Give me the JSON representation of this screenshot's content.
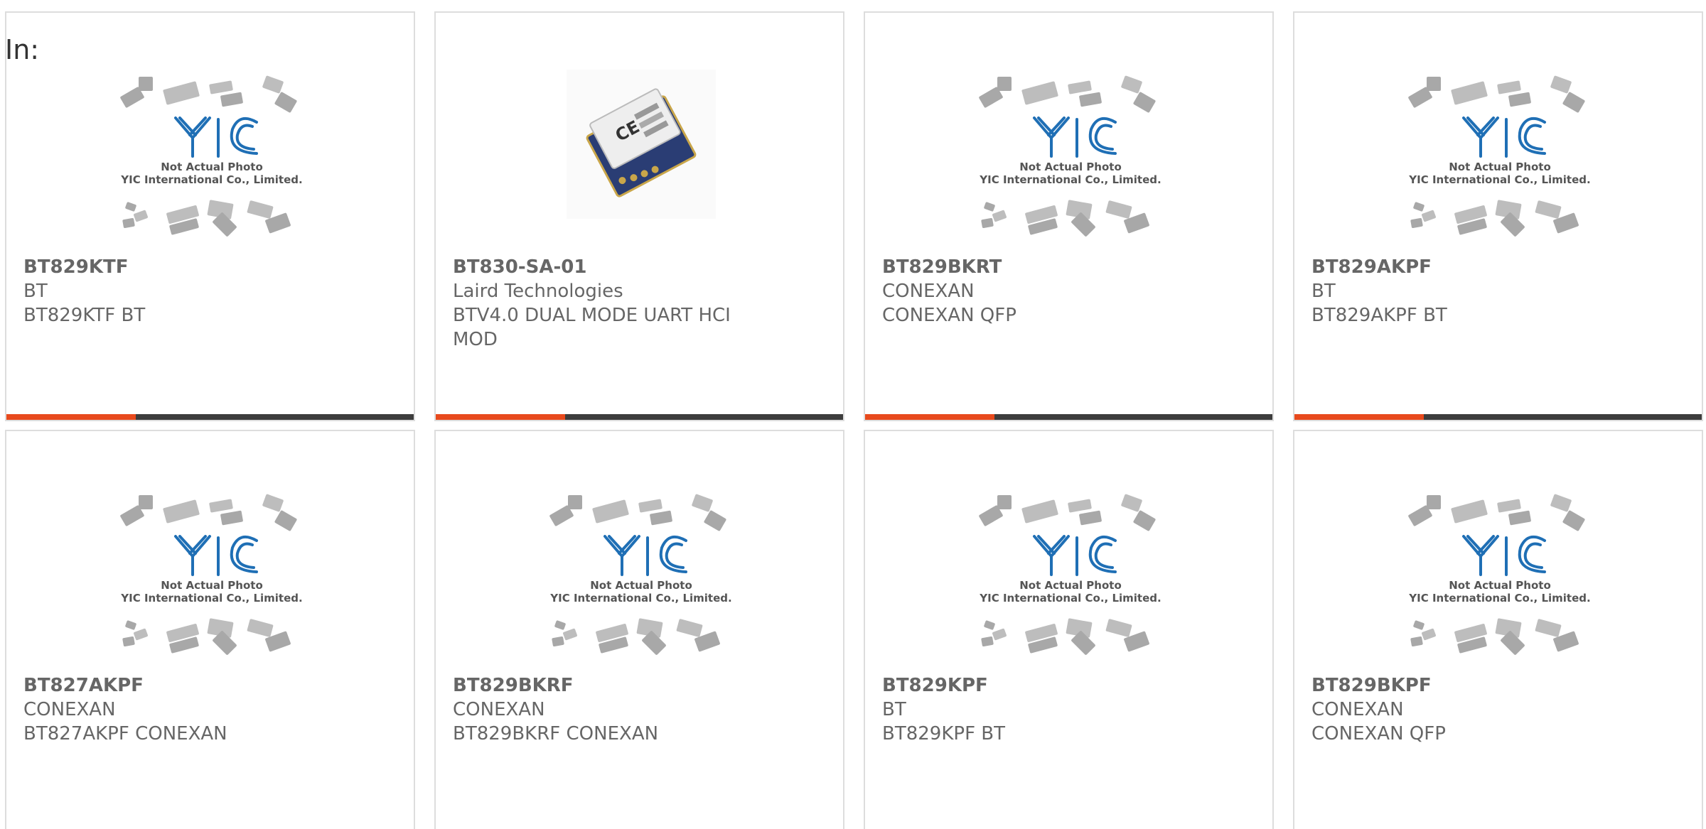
{
  "filter_label": "In:",
  "placeholder_caption": {
    "line1": "Not Actual Photo",
    "line2": "YIC International Co., Limited."
  },
  "logo_text": "YIC",
  "colors": {
    "accent": "#e84a1d",
    "bar_dark": "#3d3d3d",
    "logo_blue": "#1f6fb5",
    "text_gray": "#666666"
  },
  "products": [
    {
      "part": "BT829KTF",
      "maker": "BT",
      "desc": "BT829KTF BT",
      "image": "placeholder",
      "bar": true
    },
    {
      "part": "BT830-SA-01",
      "maker": "Laird Technologies",
      "desc": "BTV4.0 DUAL MODE UART HCI MOD",
      "image": "module-photo",
      "bar": true
    },
    {
      "part": "BT829BKRT",
      "maker": "CONEXAN",
      "desc": "CONEXAN QFP",
      "image": "placeholder",
      "bar": true
    },
    {
      "part": "BT829AKPF",
      "maker": "BT",
      "desc": "BT829AKPF BT",
      "image": "placeholder",
      "bar": true
    },
    {
      "part": "BT827AKPF",
      "maker": "CONEXAN",
      "desc": "BT827AKPF CONEXAN",
      "image": "placeholder",
      "bar": false
    },
    {
      "part": "BT829BKRF",
      "maker": "CONEXAN",
      "desc": "BT829BKRF CONEXAN",
      "image": "placeholder",
      "bar": false
    },
    {
      "part": "BT829KPF",
      "maker": "BT",
      "desc": "BT829KPF BT",
      "image": "placeholder",
      "bar": false
    },
    {
      "part": "BT829BKPF",
      "maker": "CONEXAN",
      "desc": "CONEXAN QFP",
      "image": "placeholder",
      "bar": false
    }
  ]
}
